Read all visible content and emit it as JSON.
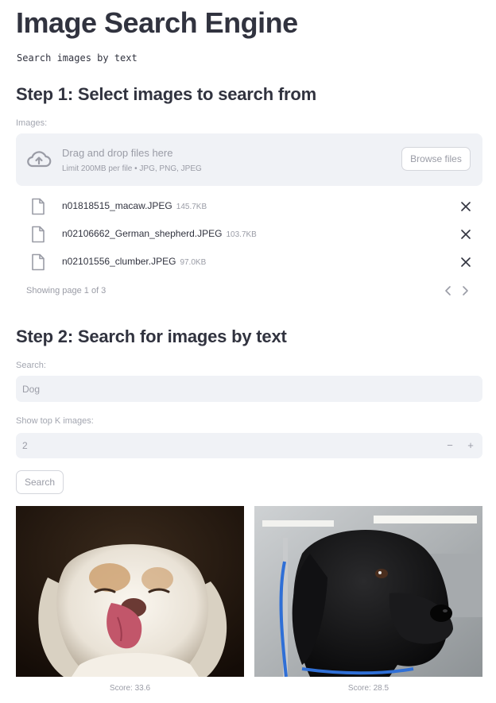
{
  "header": {
    "title": "Image Search Engine",
    "subtitle": "Search images by text"
  },
  "step1": {
    "heading": "Step 1: Select images to search from",
    "images_label": "Images:",
    "dropzone": {
      "main_text": "Drag and drop files here",
      "sub_text": "Limit 200MB per file • JPG, PNG, JPEG",
      "browse_label": "Browse files",
      "icon": "cloud-upload-icon"
    },
    "files": [
      {
        "name": "n01818515_macaw.JPEG",
        "size": "145.7KB"
      },
      {
        "name": "n02106662_German_shepherd.JPEG",
        "size": "103.7KB"
      },
      {
        "name": "n02101556_clumber.JPEG",
        "size": "97.0KB"
      }
    ],
    "pagination": {
      "text": "Showing page 1 of 3"
    }
  },
  "step2": {
    "heading": "Step 2: Search for images by text",
    "search_label": "Search:",
    "search_value": "Dog",
    "topk_label": "Show top K images:",
    "topk_value": "2",
    "minus": "−",
    "plus": "+",
    "search_button": "Search"
  },
  "results": [
    {
      "caption": "Score: 33.6",
      "subject": "white clumber spaniel licking nose"
    },
    {
      "caption": "Score: 28.5",
      "subject": "black labrador with blue leash"
    }
  ],
  "colors": {
    "text": "#31333f",
    "muted": "#9a9ca6",
    "input_bg": "#f0f2f6",
    "border": "#d4d6dc"
  }
}
